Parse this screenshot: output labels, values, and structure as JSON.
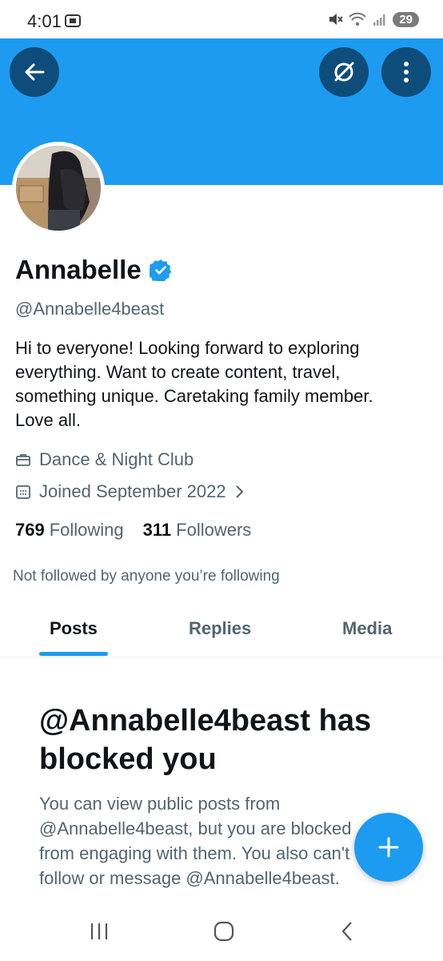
{
  "status_bar": {
    "time": "4:01",
    "battery": "29"
  },
  "profile": {
    "name": "Annabelle",
    "handle": "@Annabelle4beast",
    "bio": "Hi to everyone!  Looking forward to exploring\neverything.  Want to create content, travel,\nsomething unique.  Caretaking family member.\nLove all.",
    "category": "Dance & Night Club",
    "joined": "Joined September 2022",
    "following_count": "769",
    "following_label": "Following",
    "followers_count": "311",
    "followers_label": "Followers",
    "not_followed": "Not followed by anyone you’re following"
  },
  "tabs": [
    {
      "label": "Posts",
      "active": true
    },
    {
      "label": "Replies",
      "active": false
    },
    {
      "label": "Media",
      "active": false
    }
  ],
  "blocked": {
    "title": "@Annabelle4beast has blocked you",
    "body": "You can view public posts from\n@Annabelle4beast, but you are blocked\nfrom engaging with them. You also can't\nfollow or message @Annabelle4beast."
  },
  "icons": {
    "back": "arrow-left-icon",
    "grok": "grok-icon",
    "more": "more-vertical-icon",
    "verified": "verified-badge-icon",
    "category": "briefcase-icon",
    "joined": "calendar-icon",
    "chevron": "chevron-right-icon",
    "compose": "plus-icon"
  },
  "colors": {
    "accent": "#1d9bf0",
    "banner": "#1d9bf0",
    "header_button": "#0e4d7a",
    "secondary_text": "#536471"
  }
}
